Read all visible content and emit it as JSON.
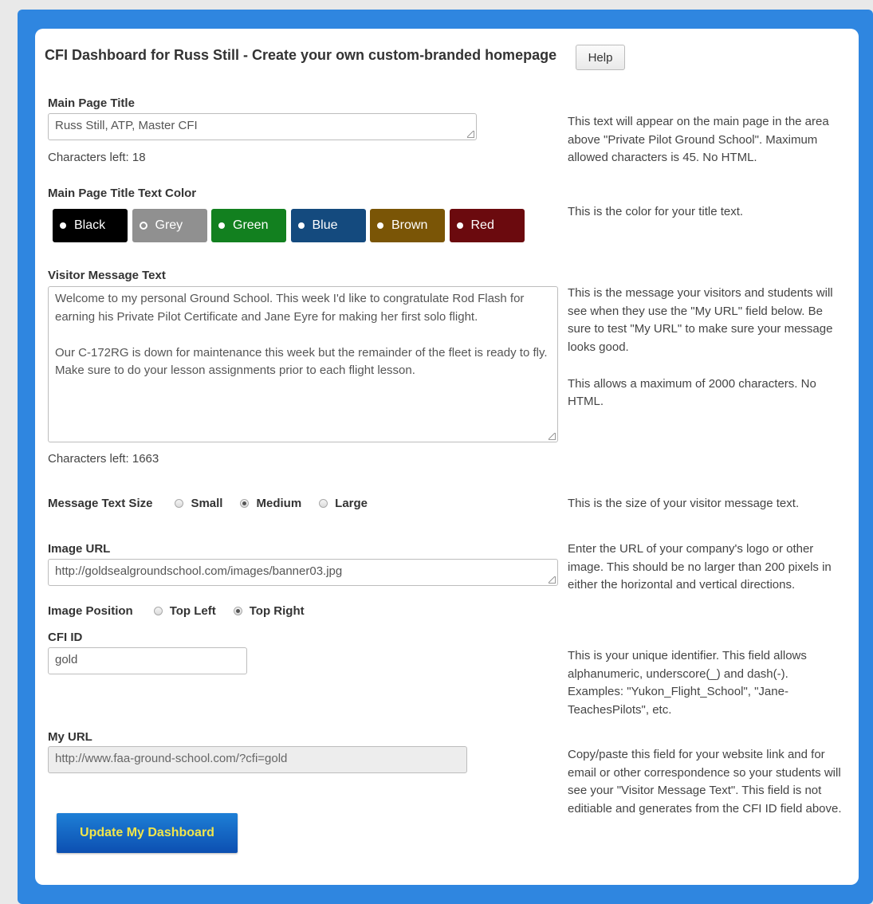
{
  "header": {
    "title": "CFI Dashboard for Russ Still - Create your own custom-branded homepage",
    "help_label": "Help"
  },
  "main_title": {
    "label": "Main Page Title",
    "value": "Russ Still, ATP, Master CFI",
    "chars_left": "Characters left: 18",
    "description": "This text will appear on the main page in the area above \"Private Pilot Ground School\". Maximum allowed characters is 45. No HTML."
  },
  "title_color": {
    "label": "Main Page Title Text Color",
    "description": "This is the color for your title text.",
    "selected": "Grey",
    "options": [
      {
        "label": "Black",
        "color": "#000000"
      },
      {
        "label": "Grey",
        "color": "#909090"
      },
      {
        "label": "Green",
        "color": "#12801f"
      },
      {
        "label": "Blue",
        "color": "#144a7e"
      },
      {
        "label": "Brown",
        "color": "#7a5506"
      },
      {
        "label": "Red",
        "color": "#6b0a0e"
      }
    ]
  },
  "visitor_message": {
    "label": "Visitor Message Text",
    "paragraph1": "Welcome to my personal Ground School. This week I'd like to congratulate Rod Flash for earning his Private Pilot Certificate and Jane Eyre for making her first solo flight.",
    "paragraph2": "Our C-172RG is down for maintenance this week but the remainder of the fleet is ready to fly. Make sure to do your lesson assignments prior to each flight lesson.",
    "chars_left": "Characters left: 1663",
    "description1": "This is the message your visitors and students will see when they use the \"My URL\" field below. Be sure to test \"My URL\" to make sure your message looks good.",
    "description2": "This allows a maximum of 2000 characters. No HTML."
  },
  "text_size": {
    "label": "Message Text Size",
    "options": [
      "Small",
      "Medium",
      "Large"
    ],
    "selected": "Medium",
    "description": "This is the size of your visitor message text."
  },
  "image_url": {
    "label": "Image URL",
    "value": "http://goldsealgroundschool.com/images/banner03.jpg",
    "description": "Enter the URL of your company's logo or other image. This should be no larger than 200 pixels in either the horizontal and vertical directions."
  },
  "image_position": {
    "label": "Image Position",
    "options": [
      "Top Left",
      "Top Right"
    ],
    "selected": "Top Right"
  },
  "cfi_id": {
    "label": "CFI ID",
    "value": "gold",
    "description": "This is your unique identifier. This field allows alphanumeric, underscore(_) and dash(-). Examples: \"Yukon_Flight_School\", \"Jane-TeachesPilots\", etc."
  },
  "my_url": {
    "label": "My URL",
    "value": "http://www.faa-ground-school.com/?cfi=gold",
    "description": "Copy/paste this field for your website link and for email or other correspondence so your students will see your \"Visitor Message Text\". This field is not editiable and generates from the CFI ID field above."
  },
  "update_button": "Update My Dashboard"
}
